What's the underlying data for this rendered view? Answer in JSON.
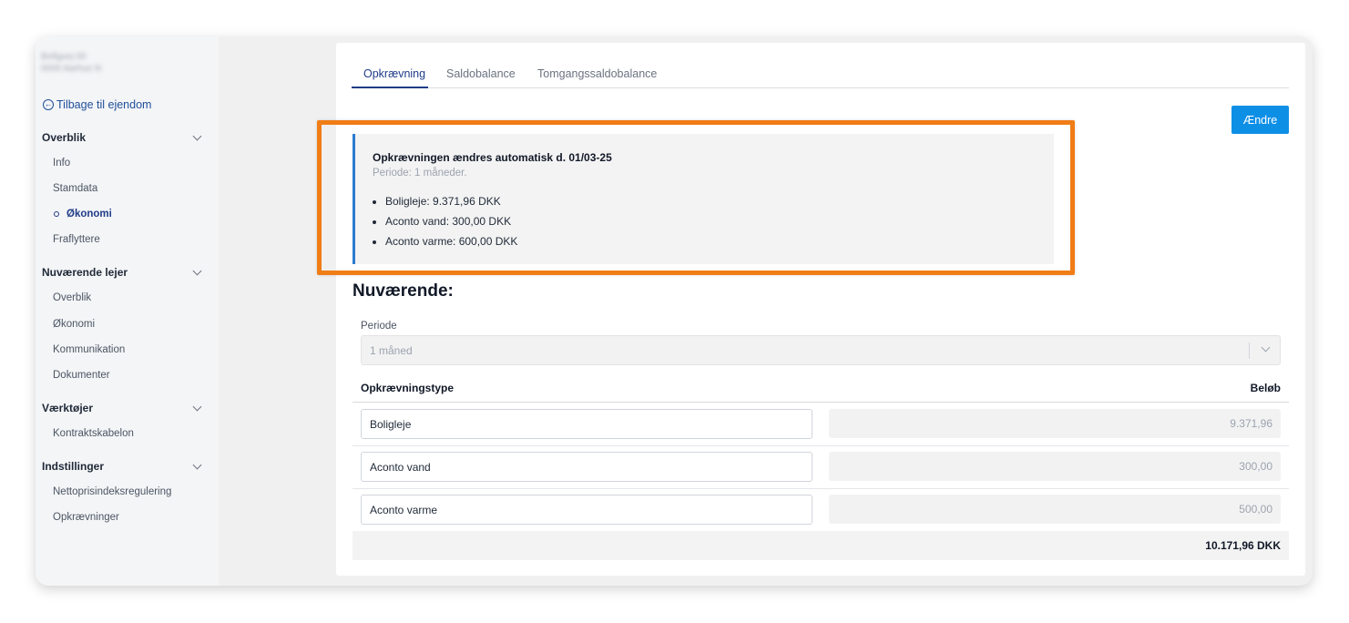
{
  "sidebar": {
    "address_line1": "Bofigvej 00",
    "address_line2": "0000 Aarhus N",
    "back_label": "Tilbage til ejendom",
    "sections": [
      {
        "title": "Overblik",
        "items": [
          "Info",
          "Stamdata",
          "Økonomi",
          "Fraflyttere"
        ]
      },
      {
        "title": "Nuværende lejer",
        "items": [
          "Overblik",
          "Økonomi",
          "Kommunikation",
          "Dokumenter"
        ]
      },
      {
        "title": "Værktøjer",
        "items": [
          "Kontraktskabelon"
        ]
      },
      {
        "title": "Indstillinger",
        "items": [
          "Nettoprisindeksregulering",
          "Opkrævninger"
        ]
      }
    ],
    "active_item": "Økonomi"
  },
  "tabs": [
    "Opkrævning",
    "Saldobalance",
    "Tomgangssaldobalance"
  ],
  "active_tab": "Opkrævning",
  "edit_button": "Ændre",
  "notice": {
    "title": "Opkrævningen ændres automatisk d. 01/03-25",
    "subtitle": "Periode: 1 måneder.",
    "items": [
      "Boligleje: 9.371,96 DKK",
      "Aconto vand: 300,00 DKK",
      "Aconto varme: 600,00 DKK"
    ]
  },
  "colors": {
    "accent": "#0e8fe6",
    "highlight": "#f07d16",
    "nav_active": "#1f3c88",
    "notice_border": "#2b7bd0"
  },
  "current": {
    "heading": "Nuværende:",
    "period_label": "Periode",
    "period_value": "1 måned",
    "col_type": "Opkrævningstype",
    "col_amount": "Beløb",
    "rows": [
      {
        "type": "Boligleje",
        "amount": "9.371,96"
      },
      {
        "type": "Aconto vand",
        "amount": "300,00"
      },
      {
        "type": "Aconto varme",
        "amount": "500,00"
      }
    ],
    "total": "10.171,96 DKK"
  }
}
